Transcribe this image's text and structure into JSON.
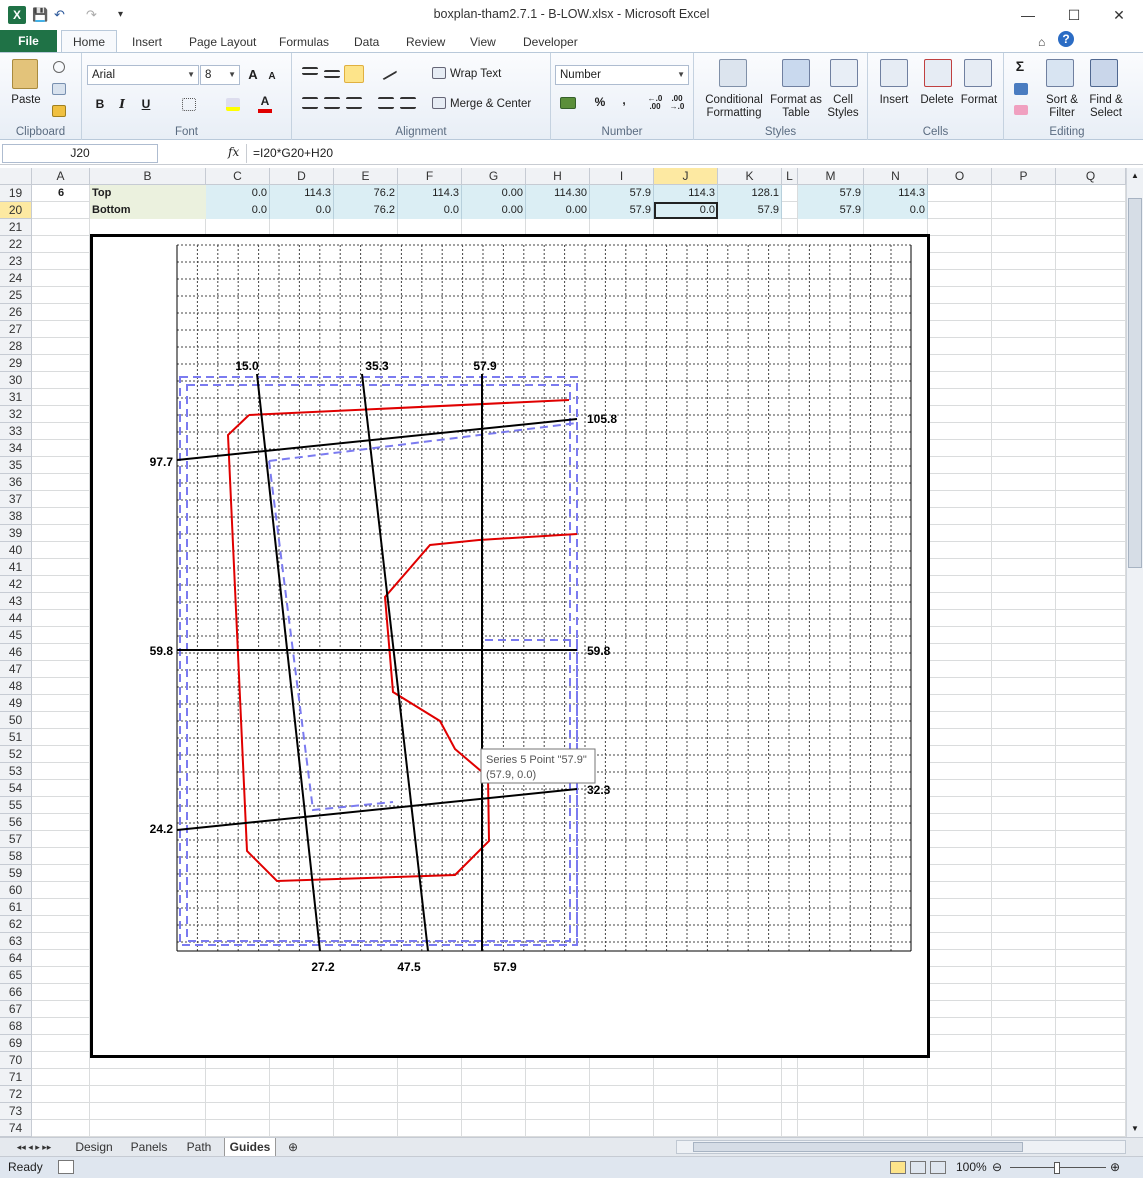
{
  "window": {
    "title": "boxplan-tham2.7.1 - B-LOW.xlsx - Microsoft Excel",
    "minimize": "—",
    "maximize": "☐",
    "close": "✕"
  },
  "qat": {
    "save": "💾",
    "undo": "↶",
    "redo": "↷",
    "customize": "▾"
  },
  "tabs": [
    "File",
    "Home",
    "Insert",
    "Page Layout",
    "Formulas",
    "Data",
    "Review",
    "View",
    "Developer"
  ],
  "active_tab": "Home",
  "ribbon": {
    "clipboard": {
      "label": "Clipboard",
      "paste": "Paste"
    },
    "font": {
      "label": "Font",
      "name": "Arial",
      "size": "8",
      "bold": "B",
      "italic": "I",
      "underline": "U",
      "grow": "A",
      "shrink": "A"
    },
    "alignment": {
      "label": "Alignment",
      "wrap": "Wrap Text",
      "merge": "Merge & Center"
    },
    "number": {
      "label": "Number",
      "format": "Number",
      "percent": "%",
      "comma": ","
    },
    "styles": {
      "label": "Styles",
      "conditional": "Conditional Formatting",
      "format_table": "Format as Table",
      "cell_styles": "Cell Styles"
    },
    "cells": {
      "label": "Cells",
      "insert": "Insert",
      "delete": "Delete",
      "format": "Format"
    },
    "editing": {
      "label": "Editing",
      "sort": "Sort & Filter",
      "find": "Find & Select",
      "sum": "Σ"
    }
  },
  "formula_bar": {
    "name_box": "J20",
    "fx": "fx",
    "formula": "=I20*G20+H20"
  },
  "columns": [
    "A",
    "B",
    "C",
    "D",
    "E",
    "F",
    "G",
    "H",
    "I",
    "J",
    "K",
    "L",
    "M",
    "N",
    "O",
    "P",
    "Q"
  ],
  "selected_column": "J",
  "rows": [
    "19",
    "20",
    "21",
    "22",
    "23",
    "24",
    "25",
    "26",
    "27",
    "28",
    "29",
    "30",
    "31",
    "32",
    "33",
    "34",
    "35",
    "36",
    "37",
    "38",
    "39",
    "40",
    "41",
    "42",
    "43",
    "44",
    "45",
    "46",
    "47",
    "48",
    "49",
    "50",
    "51",
    "52",
    "53",
    "54",
    "55",
    "56",
    "57",
    "58",
    "59",
    "60",
    "61",
    "62",
    "63",
    "64",
    "65",
    "66",
    "67",
    "68",
    "69",
    "70",
    "71",
    "72",
    "73",
    "74"
  ],
  "selected_row": "20",
  "data_rows": [
    {
      "a": "6",
      "b": "Top",
      "c": "0.0",
      "d": "114.3",
      "e": "76.2",
      "f": "114.3",
      "g": "0.00",
      "h": "114.30",
      "i": "57.9",
      "j": "114.3",
      "k": "128.1",
      "m": "57.9",
      "n": "114.3"
    },
    {
      "a": "",
      "b": "Bottom",
      "c": "0.0",
      "d": "0.0",
      "e": "76.2",
      "f": "0.0",
      "g": "0.00",
      "h": "0.00",
      "i": "57.9",
      "j": "0.0",
      "k": "57.9",
      "m": "57.9",
      "n": "0.0"
    }
  ],
  "chart_labels": {
    "top": [
      "15.0",
      "35.3",
      "57.9"
    ],
    "bottom": [
      "27.2",
      "47.5",
      "57.9"
    ],
    "left": [
      "97.7",
      "59.8",
      "24.2"
    ],
    "right": [
      "105.8",
      "59.8",
      "32.3"
    ]
  },
  "tooltip": {
    "line1": "Series 5 Point \"57.9\"",
    "line2": "(57.9, 0.0)"
  },
  "sheet_tabs": [
    "Design",
    "Panels",
    "Path",
    "Guides"
  ],
  "active_sheet": "Guides",
  "status": {
    "ready": "Ready",
    "zoom": "100%"
  },
  "colors": {
    "accent": "#1f7246",
    "red_line": "#e00000",
    "guide_blue": "#7b7bf0",
    "frame": "#000000"
  }
}
